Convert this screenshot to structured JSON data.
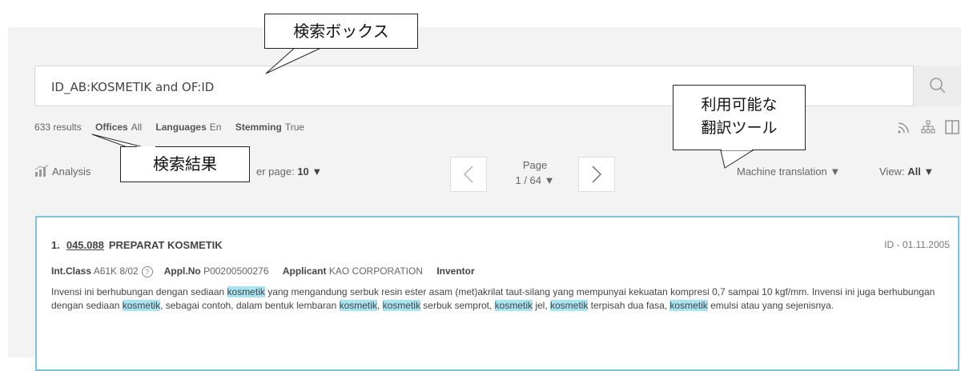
{
  "search": {
    "value": "ID_AB:KOSMETIK and OF:ID"
  },
  "meta": {
    "results": "633 results",
    "offices_label": "Offices",
    "offices_value": "All",
    "languages_label": "Languages",
    "languages_value": "En",
    "stemming_label": "Stemming",
    "stemming_value": "True"
  },
  "controls": {
    "analysis": "Analysis",
    "per_page_prefix": "er page:",
    "per_page_value": "10 ▼",
    "page_label": "Page",
    "page_value": "1 / 64 ▼",
    "machine_translation": "Machine translation ▼",
    "view_label": "View:",
    "view_value": "All ▼"
  },
  "result": {
    "num": "1.",
    "id": "045.088",
    "title": "PREPARAT KOSMETIK",
    "date": "ID - 01.11.2005",
    "intclass_label": "Int.Class",
    "intclass_value": "A61K 8/02",
    "applno_label": "Appl.No",
    "applno_value": "P00200500276",
    "applicant_label": "Applicant",
    "applicant_value": "KAO CORPORATION",
    "inventor_label": "Inventor",
    "abs1": "Invensi ini berhubungan dengan sediaan ",
    "hl": "kosmetik",
    "abs2": " yang mengandung serbuk resin ester asam (met)akrilat taut-silang yang mempunyai kekuatan kompresi 0,7 sampai 10 kgf/mm. Invensi ini juga berhubungan dengan sediaan ",
    "abs3": ", sebagai contoh, dalam bentuk lembaran ",
    "abs4": ", ",
    "abs5": " serbuk semprot, ",
    "abs6": " jel, ",
    "abs7": " terpisah dua fasa, ",
    "abs8": " emulsi atau yang sejenisnya."
  },
  "annotations": {
    "search_box": "検索ボックス",
    "results": "検索結果",
    "translation_line1": "利用可能な",
    "translation_line2": "翻訳ツール"
  }
}
